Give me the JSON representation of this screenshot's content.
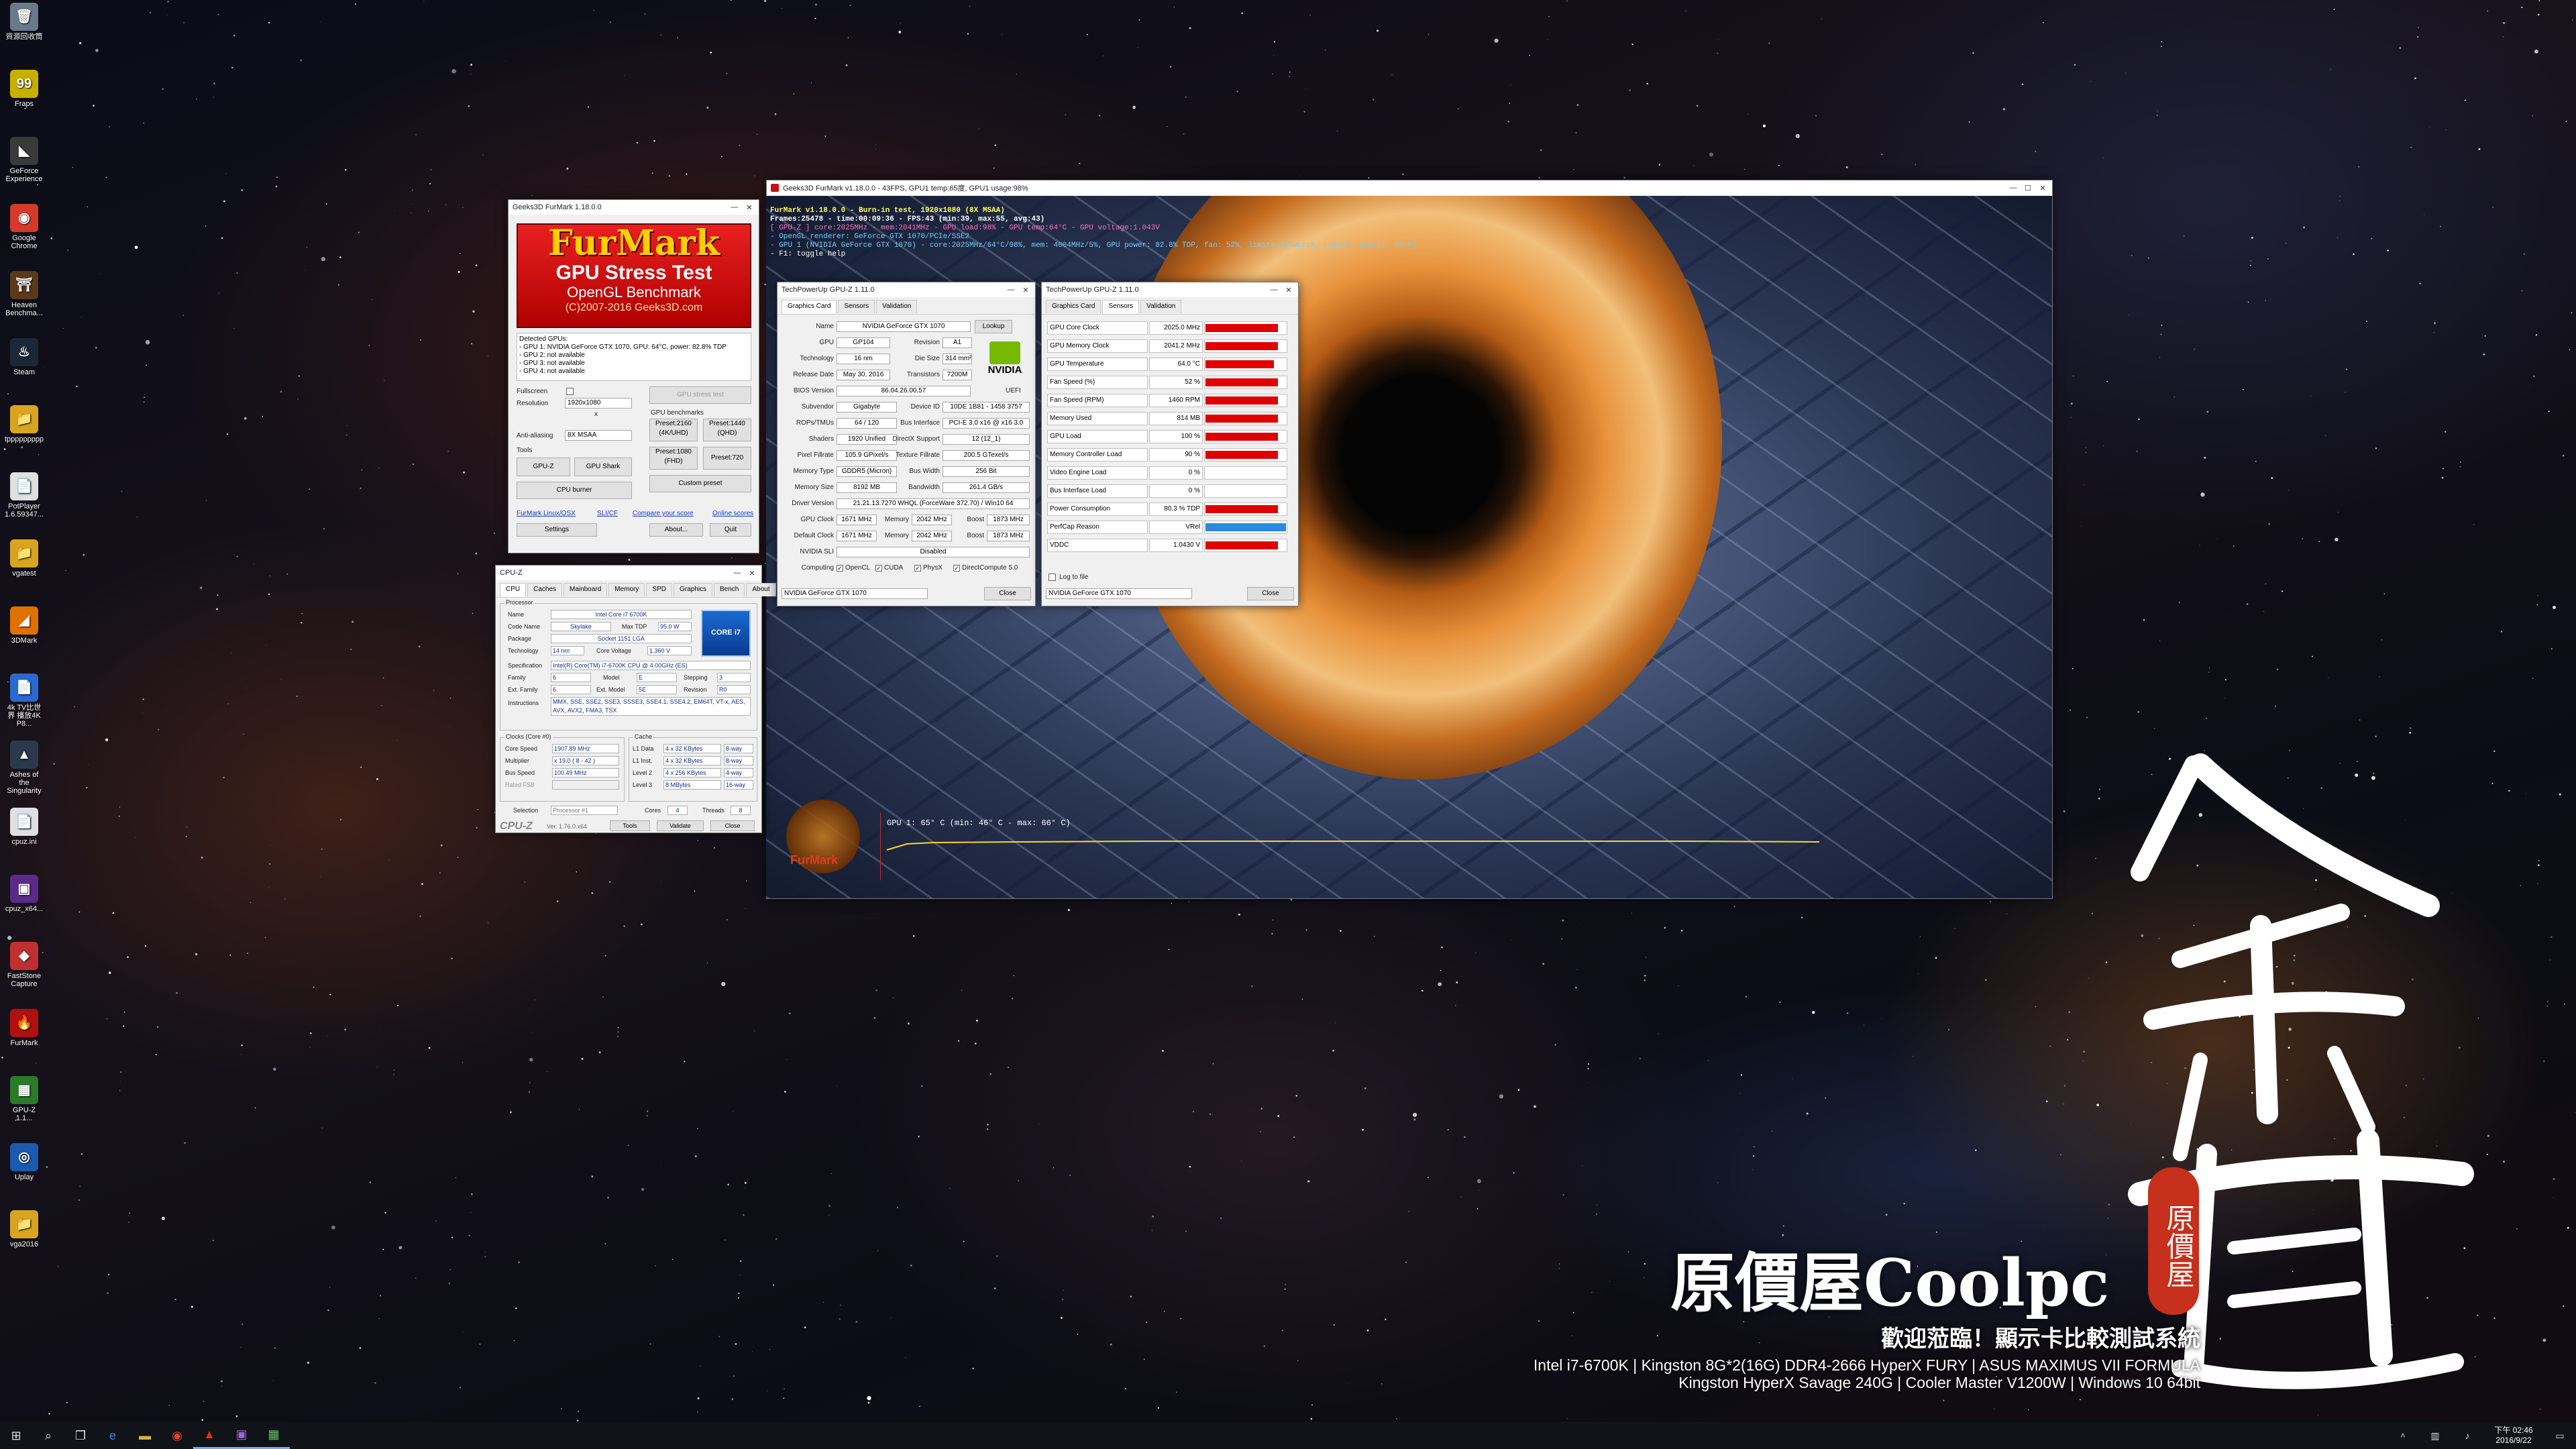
{
  "desktop_icons": [
    {
      "label": "資源回收筒",
      "glyph": "🗑",
      "color": "#6b7a8a"
    },
    {
      "label": "Fraps",
      "glyph": "99",
      "color": "#c8b000"
    },
    {
      "label": "GeForce Experience",
      "glyph": "◣",
      "color": "#3a3a3a"
    },
    {
      "label": "Google Chrome",
      "glyph": "◉",
      "color": "#d63a2a"
    },
    {
      "label": "Heaven Benchma...",
      "glyph": "⛩",
      "color": "#5a3a1a"
    },
    {
      "label": "Steam",
      "glyph": "♨",
      "color": "#1b2838"
    },
    {
      "label": "tppppppppp",
      "glyph": "📁",
      "color": "#d9a520"
    },
    {
      "label": "PotPlayer 1.6.59347...",
      "glyph": "📄",
      "color": "#e0e0e0"
    },
    {
      "label": "vgatest",
      "glyph": "📁",
      "color": "#d9a520"
    },
    {
      "label": "3DMark",
      "glyph": "◢",
      "color": "#e07000"
    },
    {
      "label": "4k TV比世界 播放4K P8...",
      "glyph": "📄",
      "color": "#2a6ad0"
    },
    {
      "label": "Ashes of the Singularity",
      "glyph": "▲",
      "color": "#2a3a4a"
    },
    {
      "label": "cpuz.ini",
      "glyph": "📄",
      "color": "#e0e0e0"
    },
    {
      "label": "cpuz_x64...",
      "glyph": "▣",
      "color": "#5a2a8a"
    },
    {
      "label": "FastStone Capture",
      "glyph": "◆",
      "color": "#c03030"
    },
    {
      "label": "FurMark",
      "glyph": "🔥",
      "color": "#b01010"
    },
    {
      "label": "GPU-Z 1.1...",
      "glyph": "▦",
      "color": "#2a7a2a"
    },
    {
      "label": "Uplay",
      "glyph": "◎",
      "color": "#1a5ab0"
    },
    {
      "label": "vga2016",
      "glyph": "📁",
      "color": "#d9a520"
    }
  ],
  "furmark_launcher": {
    "title": "Geeks3D FurMark 1.18.0.0",
    "banner_line1": "FurMark",
    "banner_line2": "GPU Stress Test",
    "banner_line3": "OpenGL Benchmark",
    "banner_line4": "(C)2007-2016 Geeks3D.com",
    "detected_label": "Detected GPUs:",
    "gpus": [
      "- GPU 1: NVIDIA GeForce GTX 1070, GPU: 64°C, power: 82.8% TDP",
      "- GPU 2: not available",
      "- GPU 3: not available",
      "- GPU 4: not available"
    ],
    "fullscreen_label": "Fullscreen",
    "resolution_label": "Resolution",
    "resolution_value": "1920x1080",
    "x_label": "x",
    "aa_label": "Anti-aliasing",
    "aa_value": "8X MSAA",
    "tools_label": "Tools",
    "gpu_stress_test": "GPU stress test",
    "gpu_benchmarks": "GPU benchmarks",
    "preset2160": "Preset:2160 (4K/UHD)",
    "preset1440": "Preset:1440 (QHD)",
    "preset1080": "Preset:1080 (FHD)",
    "preset720": "Preset:720",
    "gpuz": "GPU-Z",
    "gpushark": "GPU Shark",
    "cpuburner": "CPU burner",
    "custom_preset": "Custom preset",
    "link1": "FurMark Linux/OSX",
    "link2": "SLI/CF",
    "link3": "Compare your score",
    "link4": "Online scores",
    "settings": "Settings",
    "about": "About...",
    "quit": "Quit"
  },
  "furmark_render": {
    "title": "Geeks3D FurMark v1.18.0.0 - 43FPS, GPU1 temp:65度, GPU1 usage:98%",
    "overlay": [
      {
        "text": "FurMark v1.18.0.0 - Burn-in test, 1920x1080 (8X MSAA)",
        "color": "#ffff60"
      },
      {
        "text": "Frames:25478 - time:00:09:36 - FPS:43 (min:39, max:55, avg:43)",
        "color": "#ffffff"
      },
      {
        "text": "[ GPU-Z ] core:2025MHz - mem:2041MHz - GPU load:98% - GPU temp:64°C - GPU voltage:1.043V",
        "color": "#ff70c0"
      },
      {
        "text": "- OpenGL renderer: GeForce GTX 1070/PCIe/SSE2",
        "color": "#70d0ff"
      },
      {
        "text": "- GPU 1 (NVIDIA GeForce GTX 1070) - core:2025MHz/64°C/98%, mem: 4004MHz/5%, GPU power: 82.8% TDP, fan: 52%, limits:[power:0, temp:0, volt:1, OV:0]",
        "color": "#70d0ff"
      },
      {
        "text": "- F1: toggle help",
        "color": "#ffffff"
      }
    ],
    "temp_graph_label": "GPU 1: 65° C (min: 46° C - max: 66° C)",
    "logo_text": "FurMark"
  },
  "gpuz_card": {
    "title": "TechPowerUp GPU-Z 1.11.0",
    "tabs": [
      "Graphics Card",
      "Sensors",
      "Validation"
    ],
    "name_label": "Name",
    "name": "NVIDIA GeForce GTX 1070",
    "lookup": "Lookup",
    "gpu_label": "GPU",
    "gpu": "GP104",
    "revision_label": "Revision",
    "revision": "A1",
    "tech_label": "Technology",
    "tech": "16 nm",
    "diesize_label": "Die Size",
    "diesize": "314 mm²",
    "release_label": "Release Date",
    "release": "May 30, 2016",
    "transistors_label": "Transistors",
    "transistors": "7200M",
    "bios_label": "BIOS Version",
    "bios": "86.04.26.00.57",
    "uefi_label": "UEFI",
    "subvendor_label": "Subvendor",
    "subvendor": "Gigabyte",
    "deviceid_label": "Device ID",
    "deviceid": "10DE 1B81 - 1458 3757",
    "rops_label": "ROPs/TMUs",
    "rops": "64 / 120",
    "busif_label": "Bus Interface",
    "busif": "PCI-E 3.0 x16 @ x16 3.0",
    "shaders_label": "Shaders",
    "shaders": "1920 Unified",
    "dx_label": "DirectX Support",
    "dx": "12 (12_1)",
    "pixel_label": "Pixel Fillrate",
    "pixel": "105.9 GPixel/s",
    "texture_label": "Texture Fillrate",
    "texture": "200.5 GTexel/s",
    "memtype_label": "Memory Type",
    "memtype": "GDDR5 (Micron)",
    "buswidth_label": "Bus Width",
    "buswidth": "256 Bit",
    "memsize_label": "Memory Size",
    "memsize": "8192 MB",
    "bandwidth_label": "Bandwidth",
    "bandwidth": "261.4 GB/s",
    "driver_label": "Driver Version",
    "driver": "21.21.13.7270 WHQL (ForceWare 372.70) / Win10 64",
    "gpuclock_label": "GPU Clock",
    "gpuclock": "1671 MHz",
    "mem_label": "Memory",
    "gpumem": "2042 MHz",
    "boost_label": "Boost",
    "boost": "1873 MHz",
    "defclock_label": "Default Clock",
    "defclock": "1671 MHz",
    "defmem": "2042 MHz",
    "defboost": "1873 MHz",
    "sli_label": "NVIDIA SLI",
    "sli": "Disabled",
    "computing_label": "Computing",
    "computing": [
      "OpenCL",
      "CUDA",
      "PhysX",
      "DirectCompute 5.0"
    ],
    "select": "NVIDIA GeForce GTX 1070",
    "close": "Close",
    "brand": "NVIDIA"
  },
  "gpuz_sensors": {
    "title": "TechPowerUp GPU-Z 1.11.0",
    "tabs": [
      "Graphics Card",
      "Sensors",
      "Validation"
    ],
    "rows": [
      {
        "name": "GPU Core Clock",
        "value": "2025.0 MHz",
        "level": 0.9,
        "color": "#e00000"
      },
      {
        "name": "GPU Memory Clock",
        "value": "2041.2 MHz",
        "level": 0.9,
        "color": "#e00000"
      },
      {
        "name": "GPU Temperature",
        "value": "64.0 °C",
        "level": 0.85,
        "color": "#e00000"
      },
      {
        "name": "Fan Speed (%)",
        "value": "52 %",
        "level": 0.9,
        "color": "#e00000"
      },
      {
        "name": "Fan Speed (RPM)",
        "value": "1460 RPM",
        "level": 0.9,
        "color": "#e00000"
      },
      {
        "name": "Memory Used",
        "value": "814 MB",
        "level": 0.9,
        "color": "#e00000"
      },
      {
        "name": "GPU Load",
        "value": "100 %",
        "level": 0.9,
        "color": "#e00000"
      },
      {
        "name": "Memory Controller Load",
        "value": "90 %",
        "level": 0.9,
        "color": "#e00000"
      },
      {
        "name": "Video Engine Load",
        "value": "0 %",
        "level": 0,
        "color": "#e00000"
      },
      {
        "name": "Bus Interface Load",
        "value": "0 %",
        "level": 0,
        "color": "#e00000"
      },
      {
        "name": "Power Consumption",
        "value": "80.3 % TDP",
        "level": 0.9,
        "color": "#e00000"
      },
      {
        "name": "PerfCap Reason",
        "value": "VRel",
        "level": 1.0,
        "color": "#2a8ae0"
      },
      {
        "name": "VDDC",
        "value": "1.0430 V",
        "level": 0.9,
        "color": "#e00000"
      }
    ],
    "log_label": "Log to file",
    "select": "NVIDIA GeForce GTX 1070",
    "close": "Close"
  },
  "cpuz": {
    "title": "CPU-Z",
    "tabs": [
      "CPU",
      "Caches",
      "Mainboard",
      "Memory",
      "SPD",
      "Graphics",
      "Bench",
      "About"
    ],
    "processor_label": "Processor",
    "name_label": "Name",
    "name": "Intel Core i7 6700K",
    "codename_label": "Code Name",
    "codename": "Skylake",
    "maxtdp_label": "Max TDP",
    "maxtdp": "95.0 W",
    "package_label": "Package",
    "package": "Socket 1151 LGA",
    "tech_label": "Technology",
    "tech": "14 nm",
    "corev_label": "Core Voltage",
    "corev": "1.360 V",
    "spec_label": "Specification",
    "spec": "Intel(R) Core(TM) i7-6700K CPU @ 4.00GHz (ES)",
    "family_label": "Family",
    "family": "6",
    "model_label": "Model",
    "model": "E",
    "stepping_label": "Stepping",
    "stepping": "3",
    "extfam_label": "Ext. Family",
    "extfam": "6",
    "extmod_label": "Ext. Model",
    "extmod": "5E",
    "rev_label": "Revision",
    "rev": "R0",
    "instr_label": "Instructions",
    "instr": "MMX, SSE, SSE2, SSE3, SSSE3, SSE4.1, SSE4.2, EM64T, VT-x, AES, AVX, AVX2, FMA3, TSX",
    "clocks_label": "Clocks (Core #0)",
    "corespeed_label": "Core Speed",
    "corespeed": "1907.89 MHz",
    "mult_label": "Multiplier",
    "mult": "x 19.0 ( 8 - 42 )",
    "busspeed_label": "Bus Speed",
    "busspeed": "100.49 MHz",
    "ratedfsb_label": "Rated FSB",
    "cache_label": "Cache",
    "l1d_label": "L1 Data",
    "l1d": "4 x 32 KBytes",
    "l1d_way": "8-way",
    "l1i_label": "L1 Inst.",
    "l1i": "4 x 32 KBytes",
    "l1i_way": "8-way",
    "l2_label": "Level 2",
    "l2": "4 x 256 KBytes",
    "l2_way": "4-way",
    "l3_label": "Level 3",
    "l3": "8 MBytes",
    "l3_way": "16-way",
    "selection_label": "Selection",
    "selection": "Processor #1",
    "cores_label": "Cores",
    "cores": "4",
    "threads_label": "Threads",
    "threads": "8",
    "brand": "CPU-Z",
    "version": "Ver. 1.76.0.x64",
    "tools": "Tools",
    "validate": "Validate",
    "close": "Close",
    "badge_text": "CORE i7"
  },
  "branding": {
    "logo": "原價屋Coolpc",
    "welcome": "歡迎蒞臨！顯示卡比較測試系統",
    "spec1": "Intel i7-6700K | Kingston 8G*2(16G) DDR4-2666 HyperX FURY | ASUS MAXIMUS VII FORMULA",
    "spec2": "Kingston HyperX Savage 240G | Cooler Master V1200W | Windows 10 64bit",
    "seal": "原價屋"
  },
  "taskbar": {
    "clock": "下午 02:46",
    "date": "2016/9/22",
    "icons": [
      "windows-start",
      "search",
      "task-view",
      "edge",
      "explorer",
      "chrome",
      "furmark",
      "cpuz",
      "gpuz"
    ]
  }
}
